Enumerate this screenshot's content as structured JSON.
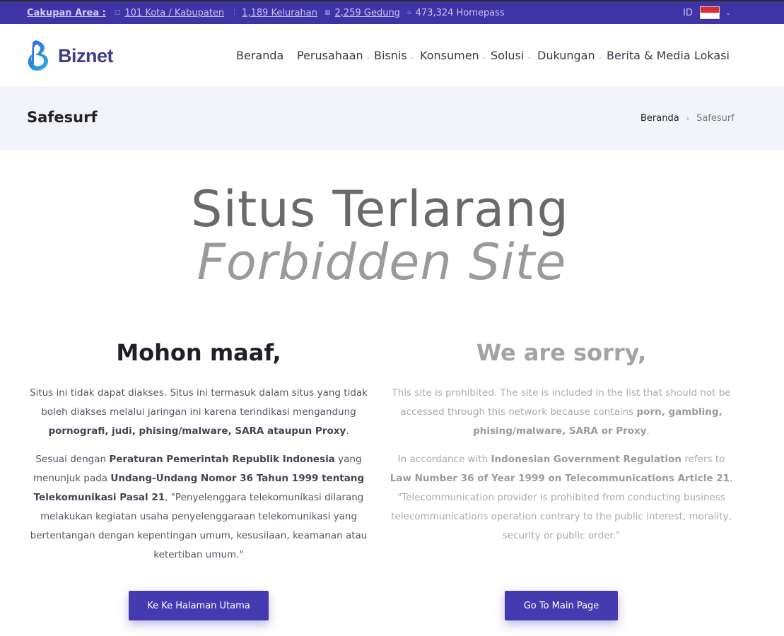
{
  "topbar": {
    "coverage_label": "Cakupan Area :",
    "items": [
      {
        "icon": "map-icon",
        "text": "101 Kota / Kabupaten"
      },
      {
        "icon": "pin-icon",
        "text": "1,189 Kelurahan"
      },
      {
        "icon": "building-icon",
        "text": "2,259 Gedung"
      },
      {
        "icon": "home-icon",
        "text": "473,324 Homepass"
      }
    ],
    "language": "ID"
  },
  "header": {
    "logo_text": "Biznet",
    "nav": [
      {
        "label": "Beranda"
      },
      {
        "label": "Perusahaan"
      },
      {
        "label": "Bisnis"
      },
      {
        "label": "Konsumen"
      },
      {
        "label": "Solusi"
      },
      {
        "label": "Dukungan"
      },
      {
        "label": "Berita & Media"
      },
      {
        "label": "Lokasi"
      }
    ]
  },
  "page": {
    "title": "Safesurf",
    "breadcrumb": {
      "home": "Beranda",
      "current": "Safesurf"
    }
  },
  "hero": {
    "line1": "Situs Terlarang",
    "line2": "Forbidden Site"
  },
  "left": {
    "heading": "Mohon maaf,",
    "p1_a": "Situs ini tidak dapat diakses. Situs ini termasuk dalam situs yang tidak boleh diakses melalui jaringan ini karena terindikasi mengandung ",
    "p1_b": "pornografi, judi, phising/malware, SARA ataupun Proxy",
    "p1_c": ".",
    "p2_a": "Sesuai dengan ",
    "p2_b": "Peraturan Pemerintah Republik Indonesia",
    "p2_c": " yang menunjuk pada ",
    "p2_d": "Undang-Undang Nomor 36 Tahun 1999 tentang Telekomunikasi Pasal 21",
    "p2_e": ", \"Penyelenggara telekomunikasi dilarang melakukan kegiatan usaha penyelenggaraan telekomunikasi yang bertentangan dengan kepentingan umum, kesusilaan, keamanan atau ketertiban umum.\"",
    "button": "Ke Ke Halaman Utama"
  },
  "right": {
    "heading": "We are sorry,",
    "p1_a": "This site is prohibited. The site is included in the list that should not be accessed through this network because contains ",
    "p1_b": "porn, gambling, phising/malware, SARA or Proxy",
    "p1_c": ".",
    "p2_a": "In accordance with ",
    "p2_b": "Indonesian Government Regulation",
    "p2_c": " refers to ",
    "p2_d": "Law Number 36 of Year 1999 on Telecommunications Article 21",
    "p2_e": ", \"Telecommunication provider is prohibited from conducting business telecommunications operation contrary to the public interest, morality, security or public order.\"",
    "button": "Go To Main Page"
  },
  "colors": {
    "brand": "#3f33a6",
    "button": "#463ab0",
    "logo_text": "#3d3d8f",
    "band": "#f3f4f9"
  }
}
